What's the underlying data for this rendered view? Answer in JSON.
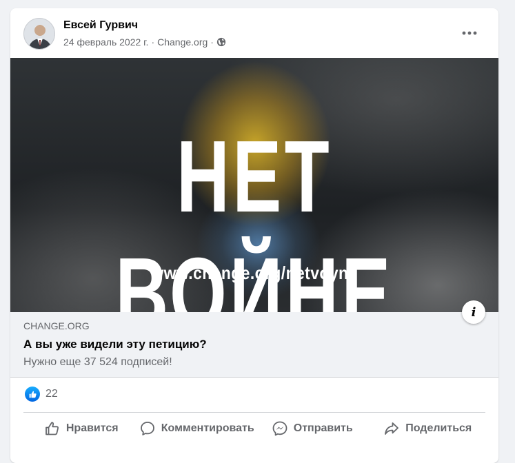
{
  "post": {
    "author": "Евсей Гурвич",
    "date": "24 февраль 2022 г.",
    "source": "Change.org",
    "separator": "·",
    "privacy_icon": "globe-icon",
    "more_icon": "more-options-icon"
  },
  "media": {
    "headline": "НЕТ ВОЙНЕ",
    "url_text": "www.change.org/netvoyne",
    "info_label": "i"
  },
  "link_preview": {
    "domain": "CHANGE.ORG",
    "title": "А вы уже видели эту петицию?",
    "subtitle": "Нужно еще 37 524 подписей!"
  },
  "reactions": {
    "icon": "like-reaction-icon",
    "count": "22"
  },
  "actions": [
    {
      "label": "Нравится",
      "icon": "thumbs-up-icon"
    },
    {
      "label": "Комментировать",
      "icon": "comment-icon"
    },
    {
      "label": "Отправить",
      "icon": "messenger-icon"
    },
    {
      "label": "Поделиться",
      "icon": "share-icon"
    }
  ],
  "colors": {
    "accent": "#0866ff",
    "text_primary": "#050505",
    "text_secondary": "#65676b",
    "background": "#f0f2f5"
  }
}
